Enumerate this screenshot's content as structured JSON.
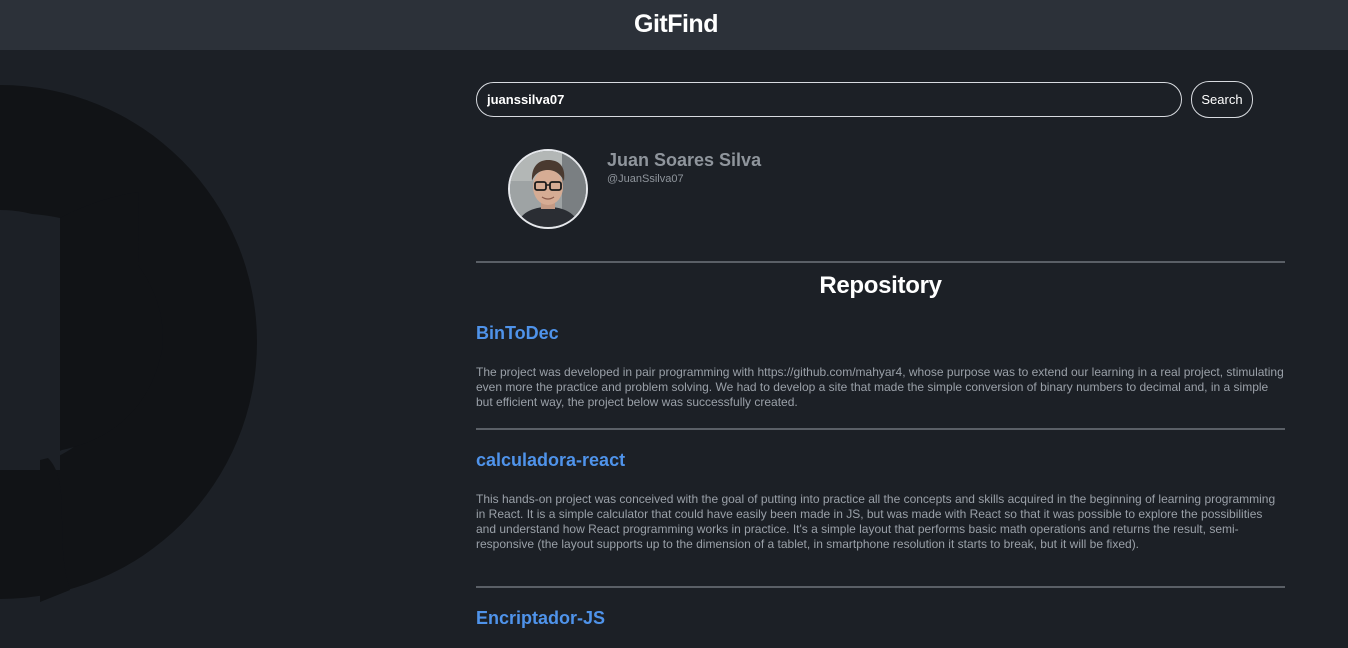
{
  "app": {
    "title": "GitFind"
  },
  "search": {
    "value": "juanssilva07",
    "placeholder": "",
    "button_label": "Search"
  },
  "profile": {
    "name": "Juan Soares Silva",
    "login": "@JuanSsilva07"
  },
  "repositories": {
    "heading": "Repository",
    "items": [
      {
        "name": "BinToDec",
        "description": "The project was developed in pair programming with https://github.com/mahyar4, whose purpose was to extend our learning in a real project, stimulating even more the practice and problem solving. We had to develop a site that made the simple conversion of binary numbers to decimal and, in a simple but efficient way, the project below was successfully created."
      },
      {
        "name": "calculadora-react",
        "description": "This hands-on project was conceived with the goal of putting into practice all the concepts and skills acquired in the beginning of learning programming in React. It is a simple calculator that could have easily been made in JS, but was made with React so that it was possible to explore the possibilities and understand how React programming works in practice. It's a simple layout that performs basic math operations and returns the result, semi-responsive (the layout supports up to the dimension of a tablet, in smartphone resolution it starts to break, but it will be fixed)."
      },
      {
        "name": "Encriptador-JS",
        "description": ""
      }
    ]
  },
  "colors": {
    "background": "#1c2026",
    "header": "#2c3139",
    "link": "#4f93ea",
    "logo": "#111316"
  },
  "icons": {
    "background_logo": "github-octocat-icon",
    "avatar": "user-avatar"
  }
}
